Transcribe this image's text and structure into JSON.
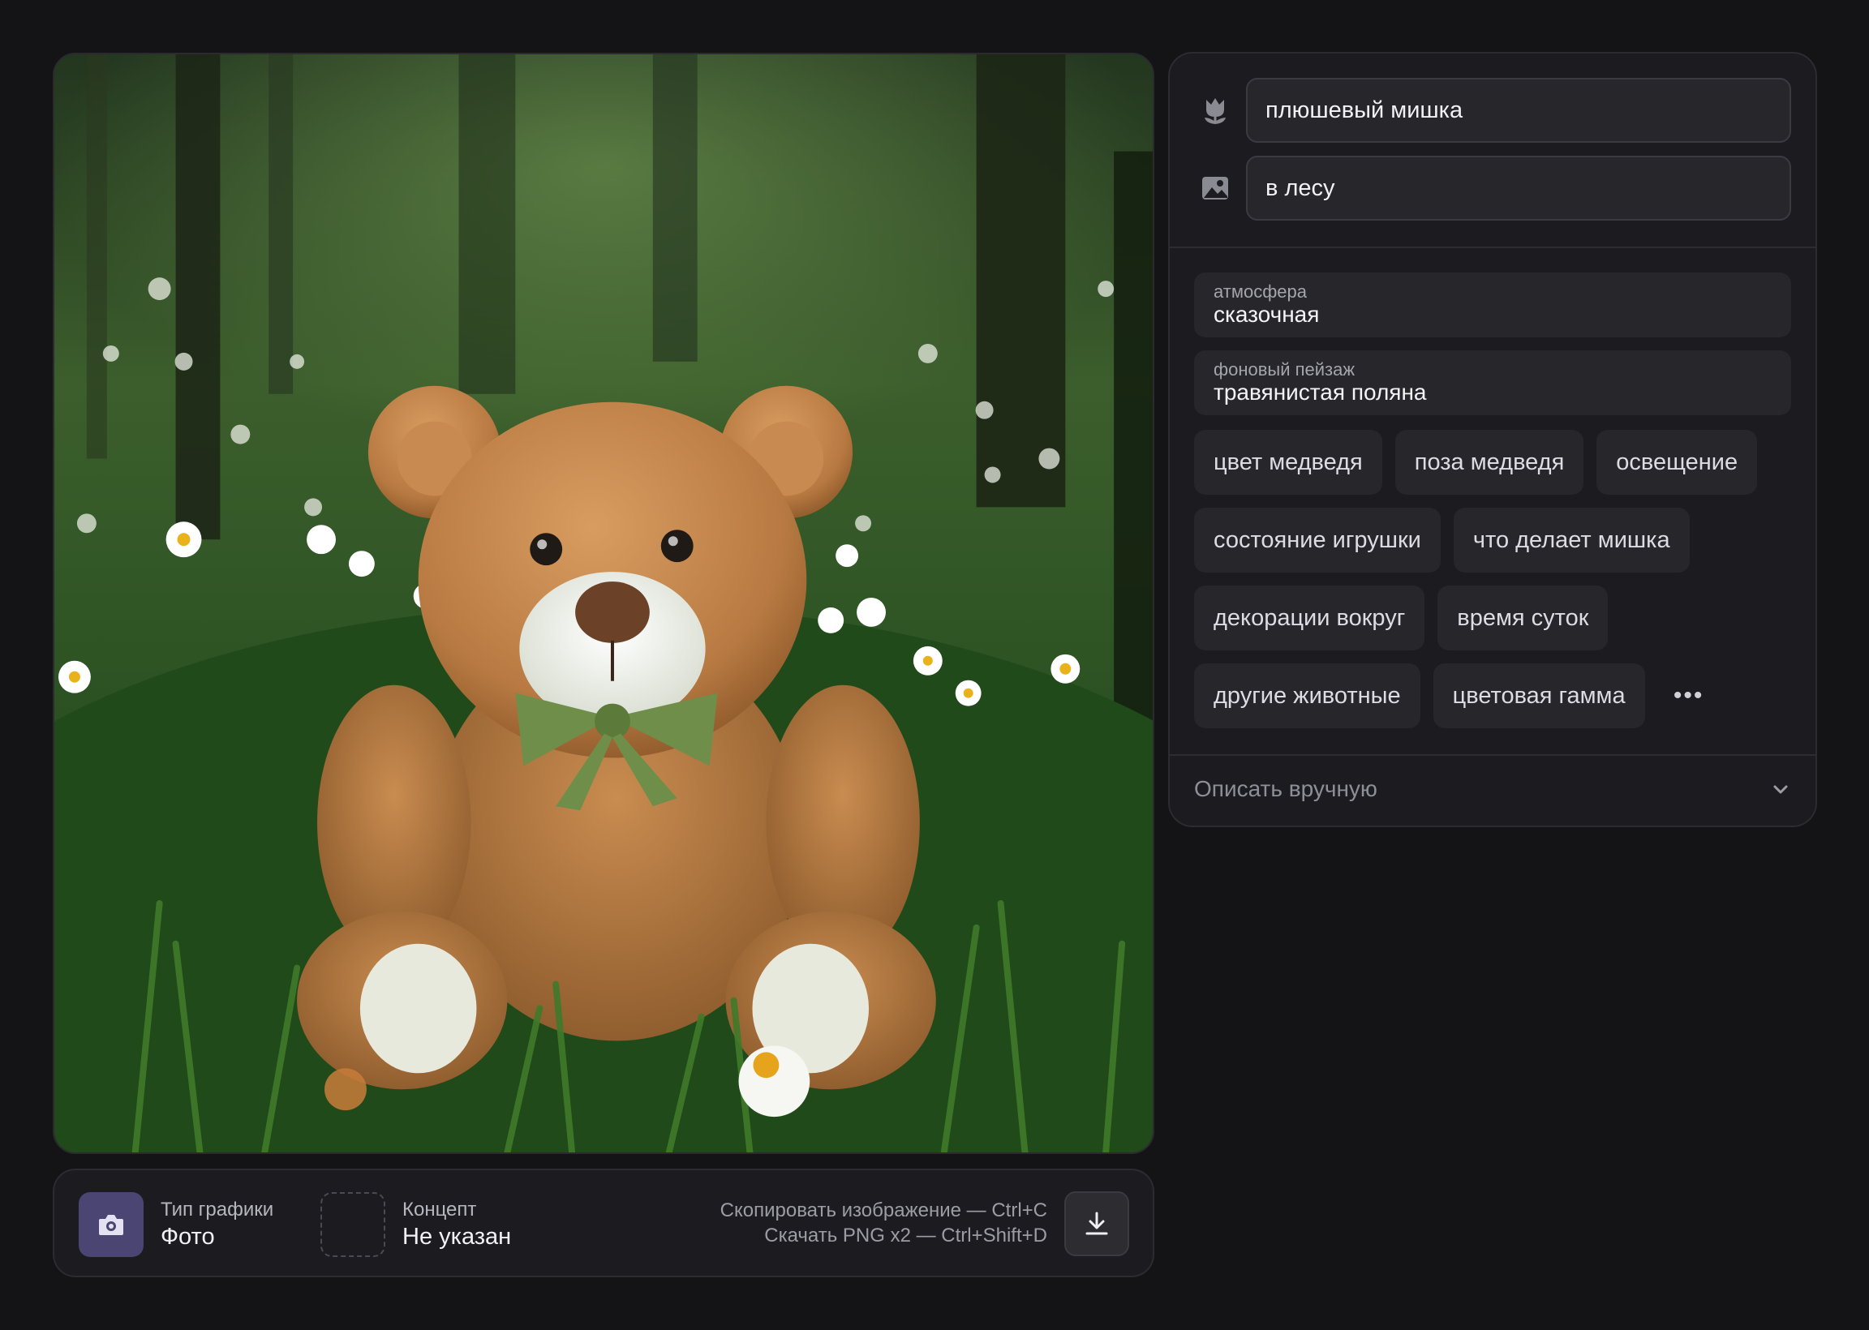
{
  "prompt": {
    "subject": "плюшевый мишка",
    "scene": "в лесу",
    "subject_icon": "tulip-icon",
    "scene_icon": "image-icon"
  },
  "fields": [
    {
      "label": "атмосфера",
      "value": "сказочная"
    },
    {
      "label": "фоновый пейзаж",
      "value": "травянистая поляна"
    }
  ],
  "chips": [
    "цвет медведя",
    "поза медведя",
    "освещение",
    "состояние игрушки",
    "что делает мишка",
    "декорации вокруг",
    "время суток",
    "другие животные",
    "цветовая гамма"
  ],
  "more_label": "•••",
  "manual": {
    "label": "Описать вручную",
    "icon": "chevron-down-icon"
  },
  "graphic_type": {
    "label": "Тип графики",
    "value": "Фото",
    "icon": "camera-icon"
  },
  "concept": {
    "label": "Концепт",
    "value": "Не указан"
  },
  "shortcuts": {
    "copy": "Скопировать изображение — Ctrl+C",
    "download": "Скачать PNG x2 — Ctrl+Shift+D"
  },
  "download_icon": "download-icon",
  "colors": {
    "background": "#141417",
    "panel": "#1c1c20",
    "field": "#26262b",
    "accent": "#4a4572"
  }
}
